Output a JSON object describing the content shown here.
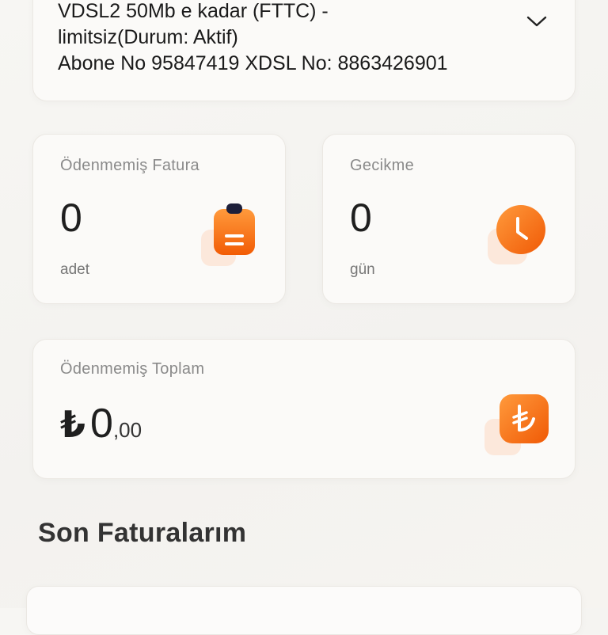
{
  "subscription": {
    "line1": "VDSL2 50Mb e kadar (FTTC) -",
    "line2": "limitsiz(Durum: Aktif)",
    "line3": "Abone No 95847419 XDSL No: 8863426901",
    "expand_icon": "chevron-down-icon"
  },
  "unpaid_invoice": {
    "label": "Ödenmemiş Fatura",
    "value": "0",
    "unit": "adet",
    "icon": "clipboard-icon"
  },
  "delay": {
    "label": "Gecikme",
    "value": "0",
    "unit": "gün",
    "icon": "clock-icon"
  },
  "unpaid_total": {
    "label": "Ödenmemiş Toplam",
    "currency": "₺",
    "integer": "0",
    "decimal": ",00",
    "icon": "lira-icon"
  },
  "recent_invoices": {
    "title": "Son Faturalarım"
  },
  "colors": {
    "accent": "#ff7a1f",
    "accent_dark": "#f25c05",
    "card_bg": "#fbfaf8",
    "page_bg": "#f4f3f0"
  }
}
